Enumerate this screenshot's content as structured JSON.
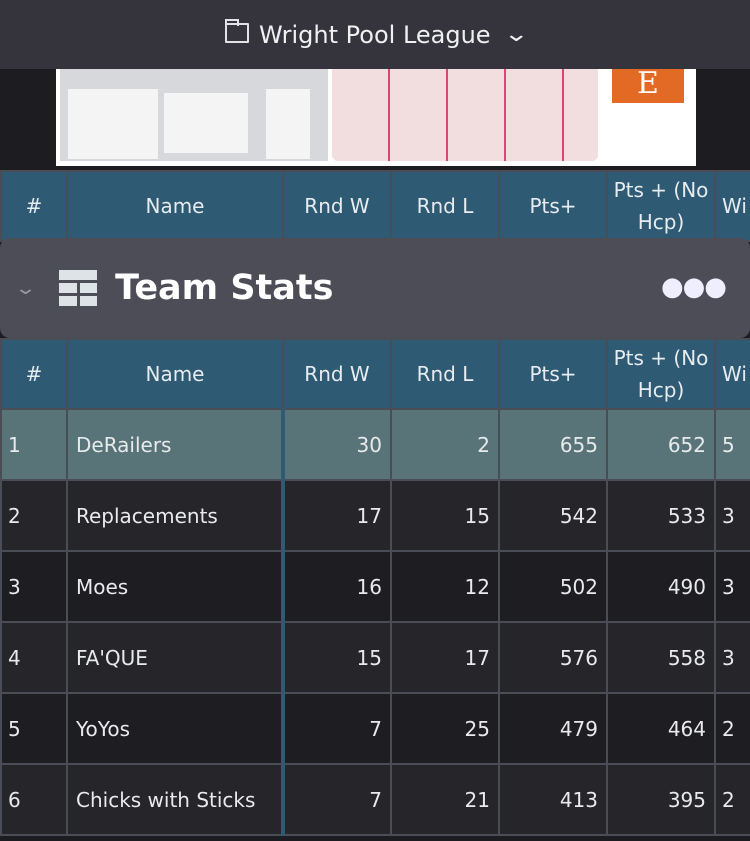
{
  "header": {
    "title": "Wright Pool League",
    "folder_icon": "folder-icon",
    "dropdown_icon": "chevron-down-icon"
  },
  "ad": {
    "logo_letter": "E"
  },
  "section": {
    "title": "Team Stats",
    "collapse_icon": "chevron-down-icon",
    "table_icon": "table-icon",
    "more_icon": "ellipsis-icon"
  },
  "table": {
    "columns": [
      "#",
      "Name",
      "Rnd W",
      "Rnd L",
      "Pts+",
      "Pts + (No Hcp)",
      "Wi"
    ],
    "rows": [
      [
        "1",
        "DeRailers",
        "30",
        "2",
        "655",
        "652",
        "5"
      ],
      [
        "2",
        "Replacements",
        "17",
        "15",
        "542",
        "533",
        "3"
      ],
      [
        "3",
        "Moes",
        "16",
        "12",
        "502",
        "490",
        "3"
      ],
      [
        "4",
        "FA'QUE",
        "15",
        "17",
        "576",
        "558",
        "3"
      ],
      [
        "5",
        "YoYos",
        "7",
        "25",
        "479",
        "464",
        "2"
      ],
      [
        "6",
        "Chicks with Sticks",
        "7",
        "21",
        "413",
        "395",
        "2"
      ]
    ]
  },
  "colors": {
    "header_bg": "#2f5a73",
    "highlight_row": "#587479",
    "panel": "#4c4d57",
    "topbar": "#35343c"
  }
}
